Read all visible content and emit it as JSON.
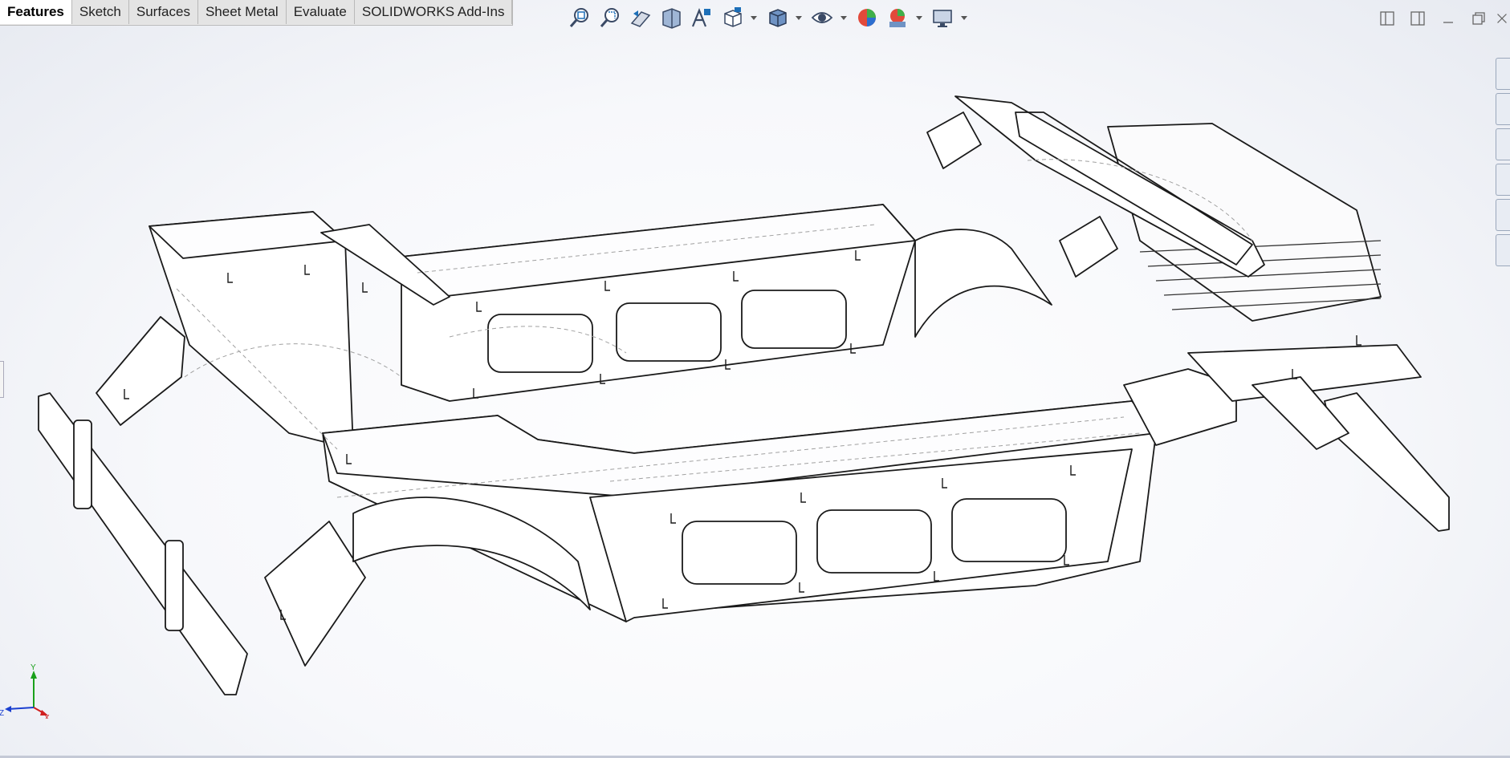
{
  "command_manager": {
    "tabs": [
      {
        "label": "Features",
        "active": true
      },
      {
        "label": "Sketch",
        "active": false
      },
      {
        "label": "Surfaces",
        "active": false
      },
      {
        "label": "Sheet Metal",
        "active": false
      },
      {
        "label": "Evaluate",
        "active": false
      },
      {
        "label": "SOLIDWORKS Add-Ins",
        "active": false
      }
    ]
  },
  "heads_up_toolbar": {
    "icons": [
      "zoom-to-fit-icon",
      "zoom-to-area-icon",
      "previous-view-icon",
      "section-view-icon",
      "dynamic-annotation-icon",
      "view-orientation-icon",
      "display-style-icon",
      "hide-show-items-icon",
      "edit-appearance-icon",
      "apply-scene-icon",
      "view-settings-icon"
    ]
  },
  "triad": {
    "x_label": "X",
    "y_label": "Y",
    "z_label": "Z",
    "x_color": "#d02020",
    "y_color": "#1aa01a",
    "z_color": "#1a3fd0"
  },
  "colors": {
    "accent": "#1d6fb8",
    "edge": "#1a1a1a",
    "hidden_edge": "#a0a0a0"
  }
}
